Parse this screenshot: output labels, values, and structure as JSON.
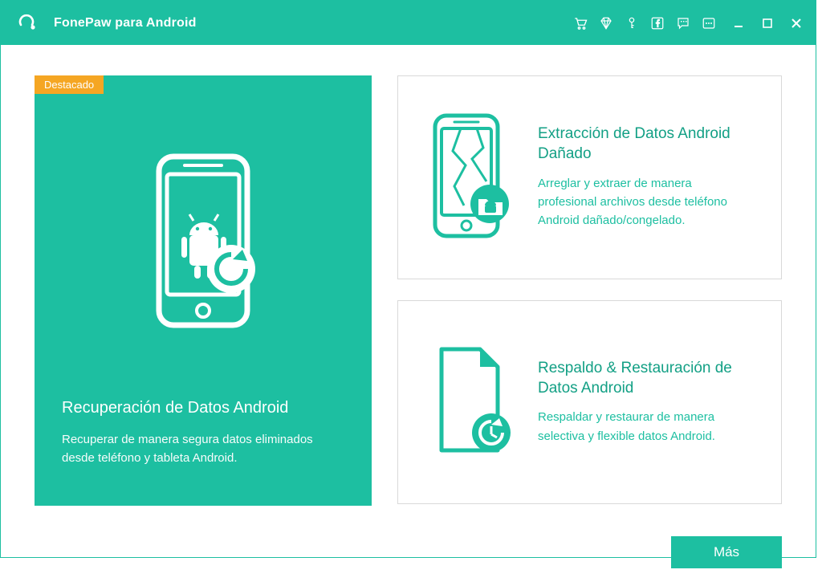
{
  "header": {
    "title": "FonePaw para Android"
  },
  "featured": {
    "badge": "Destacado",
    "title": "Recuperación de Datos Android",
    "desc": "Recuperar de manera segura datos eliminados desde teléfono y tableta Android."
  },
  "cards": [
    {
      "title": "Extracción de Datos Android Dañado",
      "desc": "Arreglar y extraer de manera profesional archivos desde teléfono Android dañado/congelado."
    },
    {
      "title": "Respaldo & Restauración de Datos Android",
      "desc": "Respaldar y restaurar de manera selectiva y flexible datos Android."
    }
  ],
  "actions": {
    "more": "Más"
  }
}
